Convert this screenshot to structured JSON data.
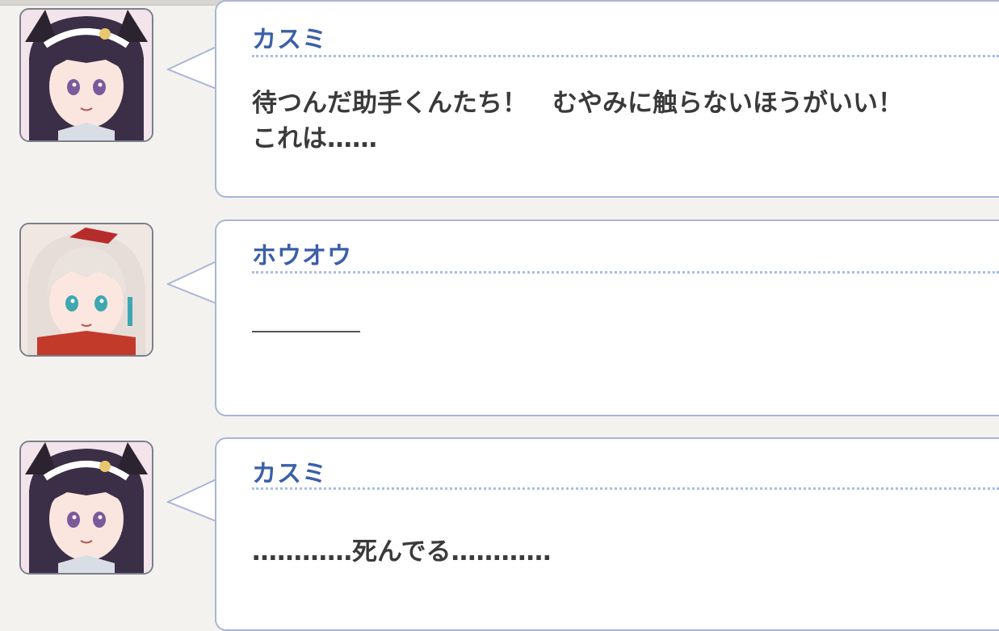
{
  "messages": [
    {
      "speaker": "カスミ",
      "text": "待つんだ助手くんたち！　むやみに触らないほうがいい！\nこれは……",
      "avatar_icon": "kasumi-avatar-icon"
    },
    {
      "speaker": "ホウオウ",
      "text": "",
      "avatar_icon": "houou-avatar-icon"
    },
    {
      "speaker": "カスミ",
      "text": "…………死んでる…………",
      "avatar_icon": "kasumi-avatar-icon"
    }
  ],
  "colors": {
    "name": "#3b5fa8",
    "bubble_border": "#a9b5d4",
    "background": "#f3f2ef"
  }
}
